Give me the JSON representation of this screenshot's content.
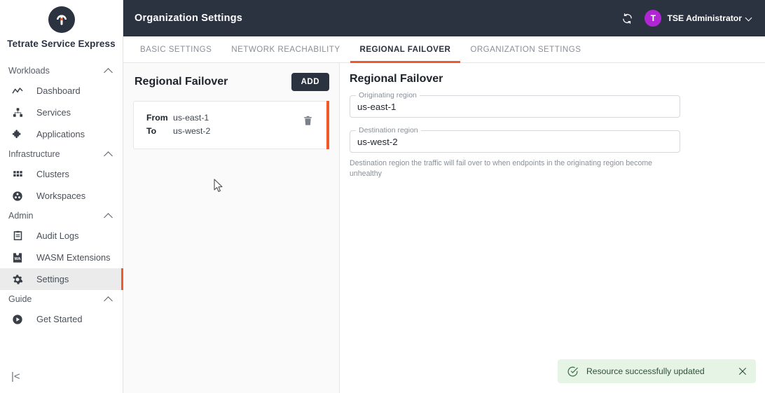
{
  "brand": {
    "name": "Tetrate Service Express",
    "logo_icon": "tetrate-logo-icon",
    "accent": "#f05a28",
    "dark": "#2b3240"
  },
  "sidebar": {
    "collapse_label": "|<",
    "groups": [
      {
        "label": "Workloads",
        "items": [
          {
            "label": "Dashboard",
            "icon": "activity-chart-icon",
            "active": false
          },
          {
            "label": "Services",
            "icon": "hierarchy-icon",
            "active": false
          },
          {
            "label": "Applications",
            "icon": "puzzle-piece-icon",
            "active": false
          }
        ]
      },
      {
        "label": "Infrastructure",
        "items": [
          {
            "label": "Clusters",
            "icon": "grid-icon",
            "active": false
          },
          {
            "label": "Workspaces",
            "icon": "circles-icon",
            "active": false
          }
        ]
      },
      {
        "label": "Admin",
        "items": [
          {
            "label": "Audit Logs",
            "icon": "clipboard-icon",
            "active": false
          },
          {
            "label": "WASM Extensions",
            "icon": "wasm-icon",
            "active": false
          },
          {
            "label": "Settings",
            "icon": "gear-icon",
            "active": true
          }
        ]
      },
      {
        "label": "Guide",
        "items": [
          {
            "label": "Get Started",
            "icon": "play-circle-icon",
            "active": false
          }
        ]
      }
    ]
  },
  "topbar": {
    "title": "Organization Settings",
    "sync_icon": "sync-refresh-icon",
    "user": {
      "initial": "T",
      "name": "TSE Administrator",
      "avatar_color": "#b026d3",
      "caret_icon": "chevron-down-icon"
    }
  },
  "tabs": [
    {
      "label": "BASIC SETTINGS",
      "active": false
    },
    {
      "label": "NETWORK REACHABILITY",
      "active": false
    },
    {
      "label": "REGIONAL FAILOVER",
      "active": true
    },
    {
      "label": "ORGANIZATION SETTINGS",
      "active": false
    }
  ],
  "list_panel": {
    "title": "Regional Failover",
    "add_label": "ADD",
    "items": [
      {
        "from_label": "From",
        "from_value": "us-east-1",
        "to_label": "To",
        "to_value": "us-west-2",
        "delete_icon": "trash-icon",
        "selected": true
      }
    ]
  },
  "detail_panel": {
    "title": "Regional Failover",
    "fields": [
      {
        "label": "Originating region",
        "value": "us-east-1",
        "placeholder": "Originating region"
      },
      {
        "label": "Destination region",
        "value": "us-west-2",
        "placeholder": "Destination region"
      }
    ],
    "helper_text": "Destination region the traffic will fail over to when endpoints in the originating region become unhealthy"
  },
  "toast": {
    "icon": "check-circle-icon",
    "message": "Resource successfully updated",
    "close_icon": "close-icon",
    "bg": "#e6f4e6"
  }
}
